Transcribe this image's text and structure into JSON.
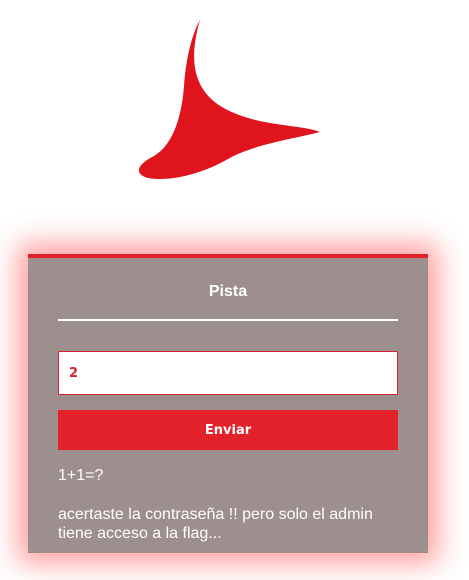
{
  "brand": {
    "logo_icon": "red-flame-logo-icon",
    "accent_color": "#e2202a"
  },
  "card": {
    "title": "Pista",
    "input": {
      "value": "2",
      "placeholder": ""
    },
    "submit_label": "Enviar",
    "hint": "1+1=?",
    "message": "acertaste la contraseña !! pero solo el admin tiene acceso a la flag..."
  }
}
